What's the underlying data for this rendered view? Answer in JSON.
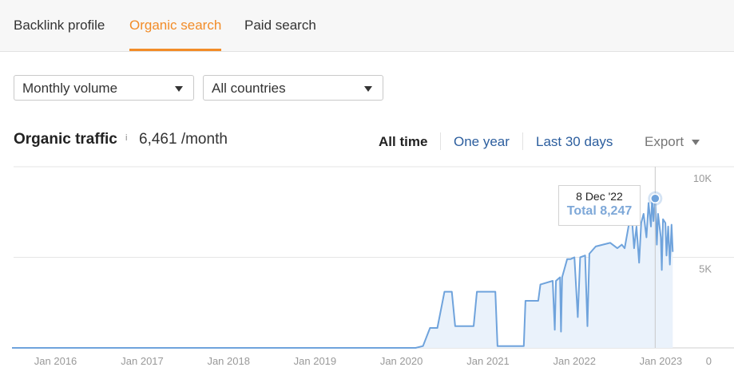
{
  "tabs": [
    {
      "label": "Backlink profile",
      "active": false
    },
    {
      "label": "Organic search",
      "active": true
    },
    {
      "label": "Paid search",
      "active": false
    }
  ],
  "filters": {
    "volume": "Monthly volume",
    "countries": "All countries"
  },
  "header": {
    "title": "Organic traffic",
    "info": "i",
    "value": "6,461 /month"
  },
  "ranges": [
    {
      "label": "All time",
      "selected": true
    },
    {
      "label": "One year",
      "selected": false
    },
    {
      "label": "Last 30 days",
      "selected": false
    }
  ],
  "export_label": "Export",
  "tooltip": {
    "date": "8 Dec '22",
    "total": "Total 8,247"
  },
  "colors": {
    "accent": "#f28c28",
    "line": "#6fa3dc",
    "fill": "#eaf2fb",
    "link": "#2c5e9e"
  },
  "chart_data": {
    "type": "area",
    "xlim": [
      "2015-07-01",
      "2023-05-01"
    ],
    "ylim": [
      0,
      10000
    ],
    "x_ticks": [
      "Jan 2016",
      "Jan 2017",
      "Jan 2018",
      "Jan 2019",
      "Jan 2020",
      "Jan 2021",
      "Jan 2022",
      "Jan 2023"
    ],
    "y_ticks": [
      "0",
      "5K",
      "10K"
    ],
    "grid": true,
    "series": [
      {
        "points": [
          [
            "2015-07-01",
            0
          ],
          [
            "2020-03-01",
            0
          ],
          [
            "2020-04-01",
            100
          ],
          [
            "2020-05-01",
            1100
          ],
          [
            "2020-06-01",
            1100
          ],
          [
            "2020-07-01",
            3100
          ],
          [
            "2020-08-01",
            3100
          ],
          [
            "2020-08-15",
            1200
          ],
          [
            "2020-11-01",
            1200
          ],
          [
            "2020-11-15",
            3100
          ],
          [
            "2021-02-01",
            3100
          ],
          [
            "2021-02-10",
            100
          ],
          [
            "2021-06-01",
            100
          ],
          [
            "2021-06-08",
            2600
          ],
          [
            "2021-08-01",
            2600
          ],
          [
            "2021-08-10",
            3500
          ],
          [
            "2021-10-01",
            3700
          ],
          [
            "2021-10-10",
            1000
          ],
          [
            "2021-10-15",
            3700
          ],
          [
            "2021-11-01",
            3900
          ],
          [
            "2021-11-05",
            900
          ],
          [
            "2021-11-10",
            3900
          ],
          [
            "2021-12-01",
            4900
          ],
          [
            "2021-12-15",
            4900
          ],
          [
            "2022-01-01",
            5000
          ],
          [
            "2022-01-15",
            1700
          ],
          [
            "2022-01-25",
            5000
          ],
          [
            "2022-02-15",
            5100
          ],
          [
            "2022-02-25",
            1200
          ],
          [
            "2022-03-05",
            5200
          ],
          [
            "2022-04-01",
            5600
          ],
          [
            "2022-05-01",
            5700
          ],
          [
            "2022-06-01",
            5800
          ],
          [
            "2022-07-01",
            5500
          ],
          [
            "2022-07-20",
            5700
          ],
          [
            "2022-08-01",
            5500
          ],
          [
            "2022-08-20",
            6900
          ],
          [
            "2022-09-01",
            7100
          ],
          [
            "2022-09-10",
            5500
          ],
          [
            "2022-09-20",
            6700
          ],
          [
            "2022-10-01",
            4700
          ],
          [
            "2022-10-10",
            6900
          ],
          [
            "2022-10-20",
            7400
          ],
          [
            "2022-11-01",
            6100
          ],
          [
            "2022-11-10",
            8000
          ],
          [
            "2022-11-20",
            6700
          ],
          [
            "2022-11-25",
            8300
          ],
          [
            "2022-12-01",
            7000
          ],
          [
            "2022-12-08",
            8247
          ],
          [
            "2022-12-15",
            5700
          ],
          [
            "2022-12-20",
            7400
          ],
          [
            "2023-01-01",
            6100
          ],
          [
            "2023-01-05",
            4300
          ],
          [
            "2023-01-10",
            7100
          ],
          [
            "2023-01-20",
            6900
          ],
          [
            "2023-01-25",
            5100
          ],
          [
            "2023-02-01",
            6700
          ],
          [
            "2023-02-08",
            4600
          ],
          [
            "2023-02-15",
            6800
          ],
          [
            "2023-02-20",
            5300
          ]
        ]
      }
    ],
    "highlight": {
      "x": "2022-12-08",
      "y": 8247
    }
  }
}
